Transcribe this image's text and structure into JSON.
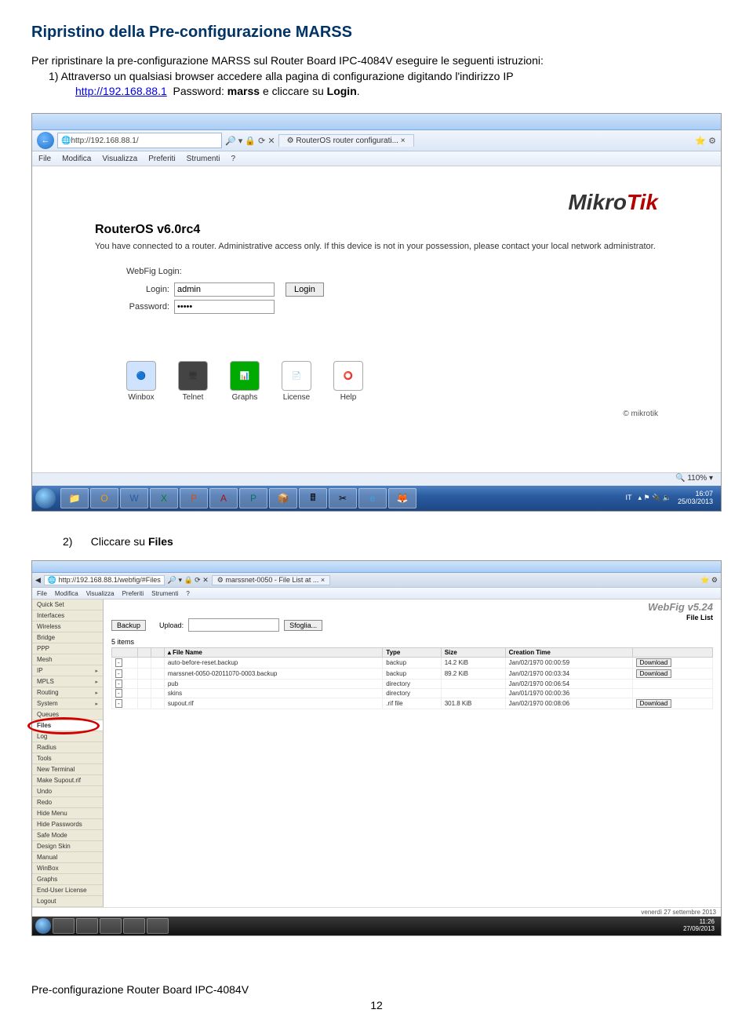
{
  "doc": {
    "title": "Ripristino della Pre-configurazione MARSS",
    "intro": "Per ripristinare la pre-configurazione MARSS sul Router Board IPC-4084V eseguire le seguenti istruzioni:",
    "step1_prefix": "1)",
    "step1_text": "Attraverso un qualsiasi browser accedere alla pagina di configurazione digitando l'indirizzo IP",
    "url": "http://192.168.88.1",
    "pw_label": "Password:",
    "pw_value": "marss",
    "pw_suffix": "e cliccare su",
    "login_word": "Login",
    "step2_prefix": "2)",
    "step2_text": "Cliccare su",
    "step2_bold": "Files",
    "footer": "Pre-configurazione Router Board IPC-4084V",
    "page_number": "12"
  },
  "shot1": {
    "url_display": "http://192.168.88.1/",
    "tab_title": "RouterOS router configurati... ×",
    "menus": [
      "File",
      "Modifica",
      "Visualizza",
      "Preferiti",
      "Strumenti",
      "?"
    ],
    "brand_left": "Mikro",
    "brand_right": "Tik",
    "router_title": "RouterOS v6.0rc4",
    "router_desc": "You have connected to a router. Administrative access only. If this device is not in your possession, please contact your local network administrator.",
    "webfig_login_label": "WebFig Login:",
    "login_label": "Login:",
    "login_value": "admin",
    "password_label": "Password:",
    "password_value": "•••••",
    "login_btn": "Login",
    "apps": [
      "Winbox",
      "Telnet",
      "Graphs",
      "License",
      "Help"
    ],
    "copyright": "© mikrotik",
    "zoom": "110%",
    "lang": "IT",
    "clock": "16:07",
    "date": "25/03/2013"
  },
  "shot2": {
    "url_display": "http://192.168.88.1/webfig/#Files",
    "tab_title": "marssnet-0050 - File List at ... ×",
    "menus": [
      "File",
      "Modifica",
      "Visualizza",
      "Preferiti",
      "Strumenti",
      "?"
    ],
    "side_menu": [
      "Quick Set",
      "Interfaces",
      "Wireless",
      "Bridge",
      "PPP",
      "Mesh",
      "IP",
      "MPLS",
      "Routing",
      "System",
      "Queues",
      "Files",
      "Log",
      "Radius",
      "Tools",
      "New Terminal",
      "Make Supout.rif",
      "Undo",
      "Redo",
      "Hide Menu",
      "Hide Passwords",
      "Safe Mode",
      "Design Skin",
      "Manual",
      "WinBox",
      "Graphs",
      "End-User License",
      "Logout"
    ],
    "side_menu_sub": [
      "IP",
      "MPLS",
      "Routing",
      "System"
    ],
    "webfig_brand": "WebFig v5.24",
    "file_list_label": "File List",
    "backup_btn": "Backup",
    "upload_label": "Upload:",
    "browse_btn": "Sfoglia...",
    "count": "5 items",
    "columns": [
      "",
      "",
      "",
      "▴ File Name",
      "Type",
      "Size",
      "Creation Time",
      ""
    ],
    "rows": [
      {
        "name": "auto-before-reset.backup",
        "type": "backup",
        "size": "14.2 KiB",
        "ctime": "Jan/02/1970 00:00:59",
        "dl": "Download"
      },
      {
        "name": "marssnet-0050-02011070-0003.backup",
        "type": "backup",
        "size": "89.2 KiB",
        "ctime": "Jan/02/1970 00:03:34",
        "dl": "Download"
      },
      {
        "name": "pub",
        "type": "directory",
        "size": "",
        "ctime": "Jan/02/1970 00:06:54",
        "dl": ""
      },
      {
        "name": "skins",
        "type": "directory",
        "size": "",
        "ctime": "Jan/01/1970 00:00:36",
        "dl": ""
      },
      {
        "name": "supout.rif",
        "type": ".rif file",
        "size": "301.8 KiB",
        "ctime": "Jan/02/1970 00:08:06",
        "dl": "Download"
      }
    ],
    "status_date": "venerdì 27 settembre 2013",
    "clock": "11:26",
    "date": "27/09/2013"
  }
}
